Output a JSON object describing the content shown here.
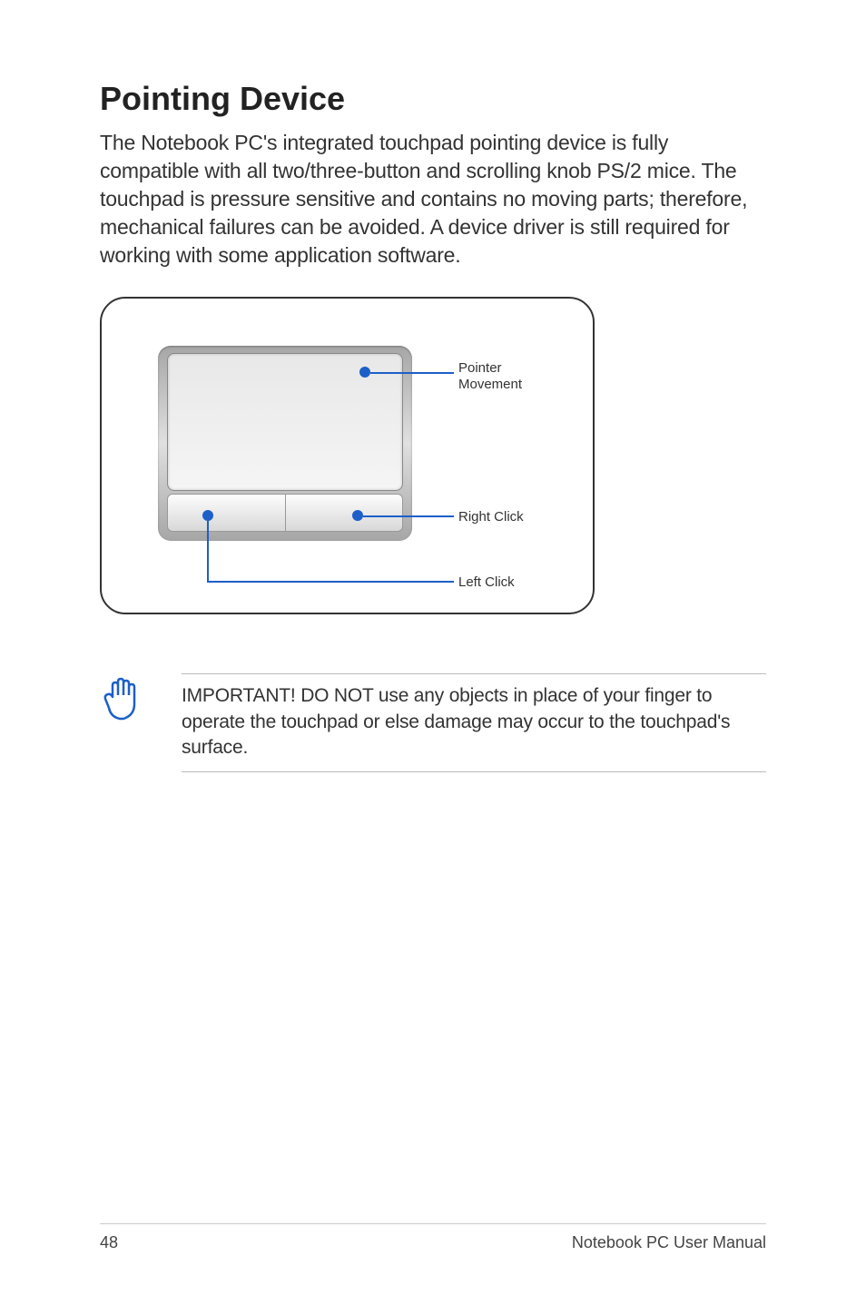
{
  "heading": "Pointing Device",
  "intro": "The Notebook PC's integrated touchpad pointing device is fully compatible with all two/three-button and scrolling knob PS/2 mice. The touchpad is pressure sensitive and contains no moving parts; therefore, mechanical failures can be avoided. A device driver is still required for working with some application software.",
  "diagram": {
    "labels": {
      "pointer": "Pointer\nMovement",
      "right_click": "Right Click",
      "left_click": "Left Click"
    }
  },
  "note": "IMPORTANT! DO NOT use any objects in place of your finger to operate the touchpad or else damage may occur to the touchpad's surface.",
  "footer": {
    "page": "48",
    "title": "Notebook PC User Manual"
  }
}
